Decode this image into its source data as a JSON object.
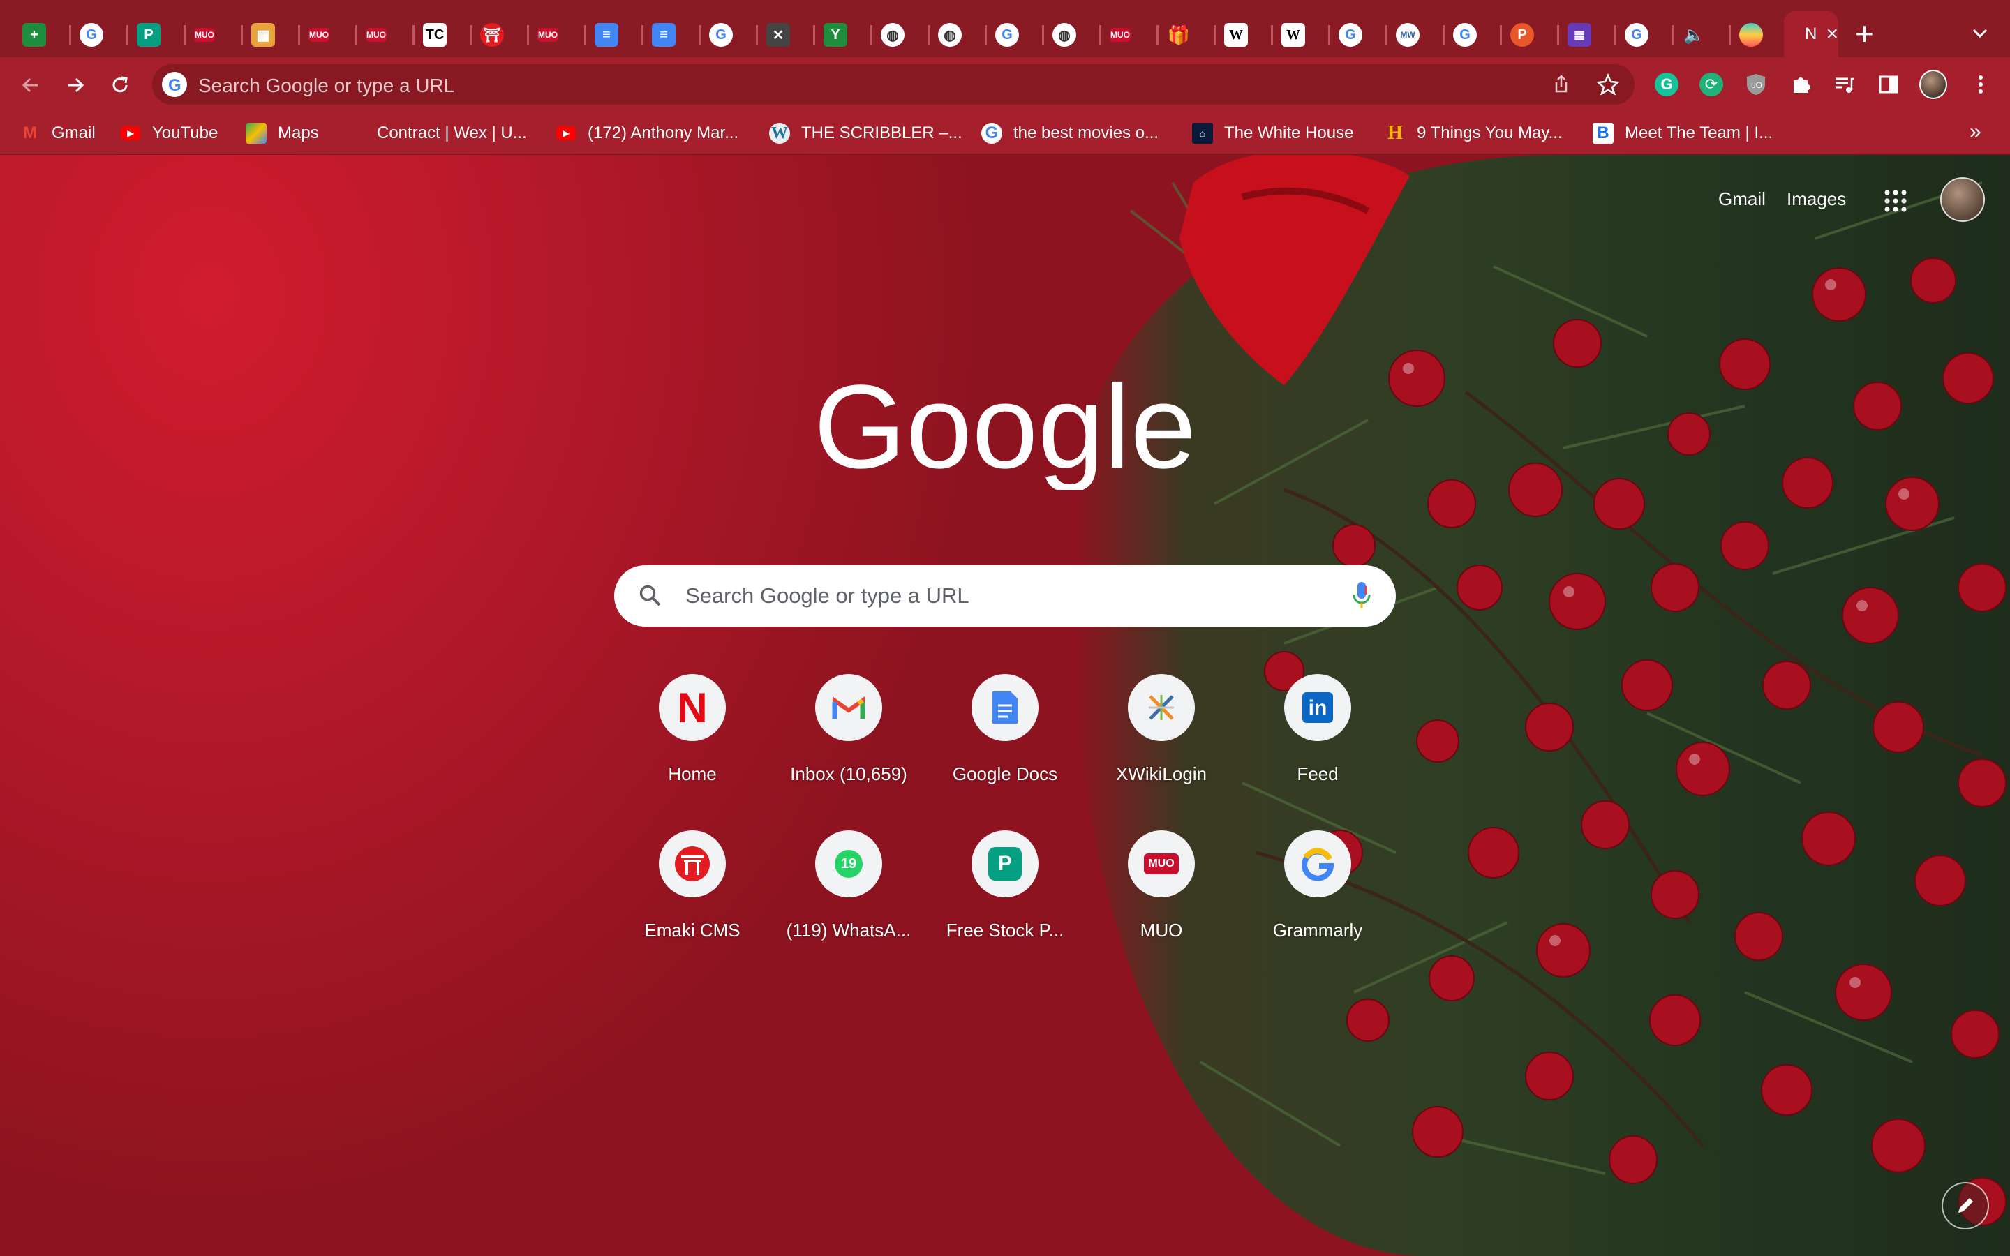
{
  "tabs": {
    "favicons": [
      "sheets-icon",
      "google-icon",
      "pexels-icon",
      "muo-icon",
      "store-icon",
      "muo-icon",
      "muo-icon",
      "techcrunch-icon",
      "emaki-icon",
      "muo-icon",
      "docs-icon",
      "docs-icon",
      "google-icon",
      "xwiki-icon",
      "xcel-icon",
      "globe-icon",
      "globe-icon",
      "google-icon",
      "globe-icon",
      "muo-icon",
      "gift-icon",
      "wikipedia-icon",
      "wikipedia-icon",
      "google-icon",
      "merriam-webster-icon",
      "google-icon",
      "canva-icon",
      "forms-icon",
      "google-icon",
      "audio-icon",
      "spotlight-icon"
    ],
    "active_title": "N",
    "new_tab_label": "+"
  },
  "toolbar": {
    "omnibox_placeholder": "Search Google or type a URL"
  },
  "bookmarks": [
    {
      "label": "Gmail",
      "icon": "gmail-icon"
    },
    {
      "label": "YouTube",
      "icon": "youtube-icon"
    },
    {
      "label": "Maps",
      "icon": "maps-icon"
    },
    {
      "label": "Contract | Wex | U...",
      "icon": "blank"
    },
    {
      "label": "(172) Anthony Mar...",
      "icon": "youtube-icon"
    },
    {
      "label": "THE SCRIBBLER –...",
      "icon": "wordpress-icon"
    },
    {
      "label": "the best movies o...",
      "icon": "google-icon"
    },
    {
      "label": "The White House",
      "icon": "whitehouse-icon"
    },
    {
      "label": "9 Things You May...",
      "icon": "h-icon"
    },
    {
      "label": "Meet The Team | I...",
      "icon": "b-icon"
    }
  ],
  "bookmarks_more": "»",
  "ntp": {
    "gmail_link": "Gmail",
    "images_link": "Images",
    "search_placeholder": "Search Google or type a URL",
    "logo_text": "Google",
    "shortcuts": [
      {
        "label": "Home",
        "icon": "netflix-icon"
      },
      {
        "label": "Inbox (10,659)",
        "icon": "gmail-icon"
      },
      {
        "label": "Google Docs",
        "icon": "docs-icon"
      },
      {
        "label": "XWikiLogin",
        "icon": "xwiki-icon"
      },
      {
        "label": "Feed",
        "icon": "linkedin-icon"
      },
      {
        "label": "Emaki CMS",
        "icon": "emaki-icon"
      },
      {
        "label": "(119) WhatsA...",
        "icon": "whatsapp-icon"
      },
      {
        "label": "Free Stock P...",
        "icon": "pexels-icon"
      },
      {
        "label": "MUO",
        "icon": "muo-icon"
      },
      {
        "label": "Grammarly",
        "icon": "grammarly-icon"
      }
    ]
  }
}
